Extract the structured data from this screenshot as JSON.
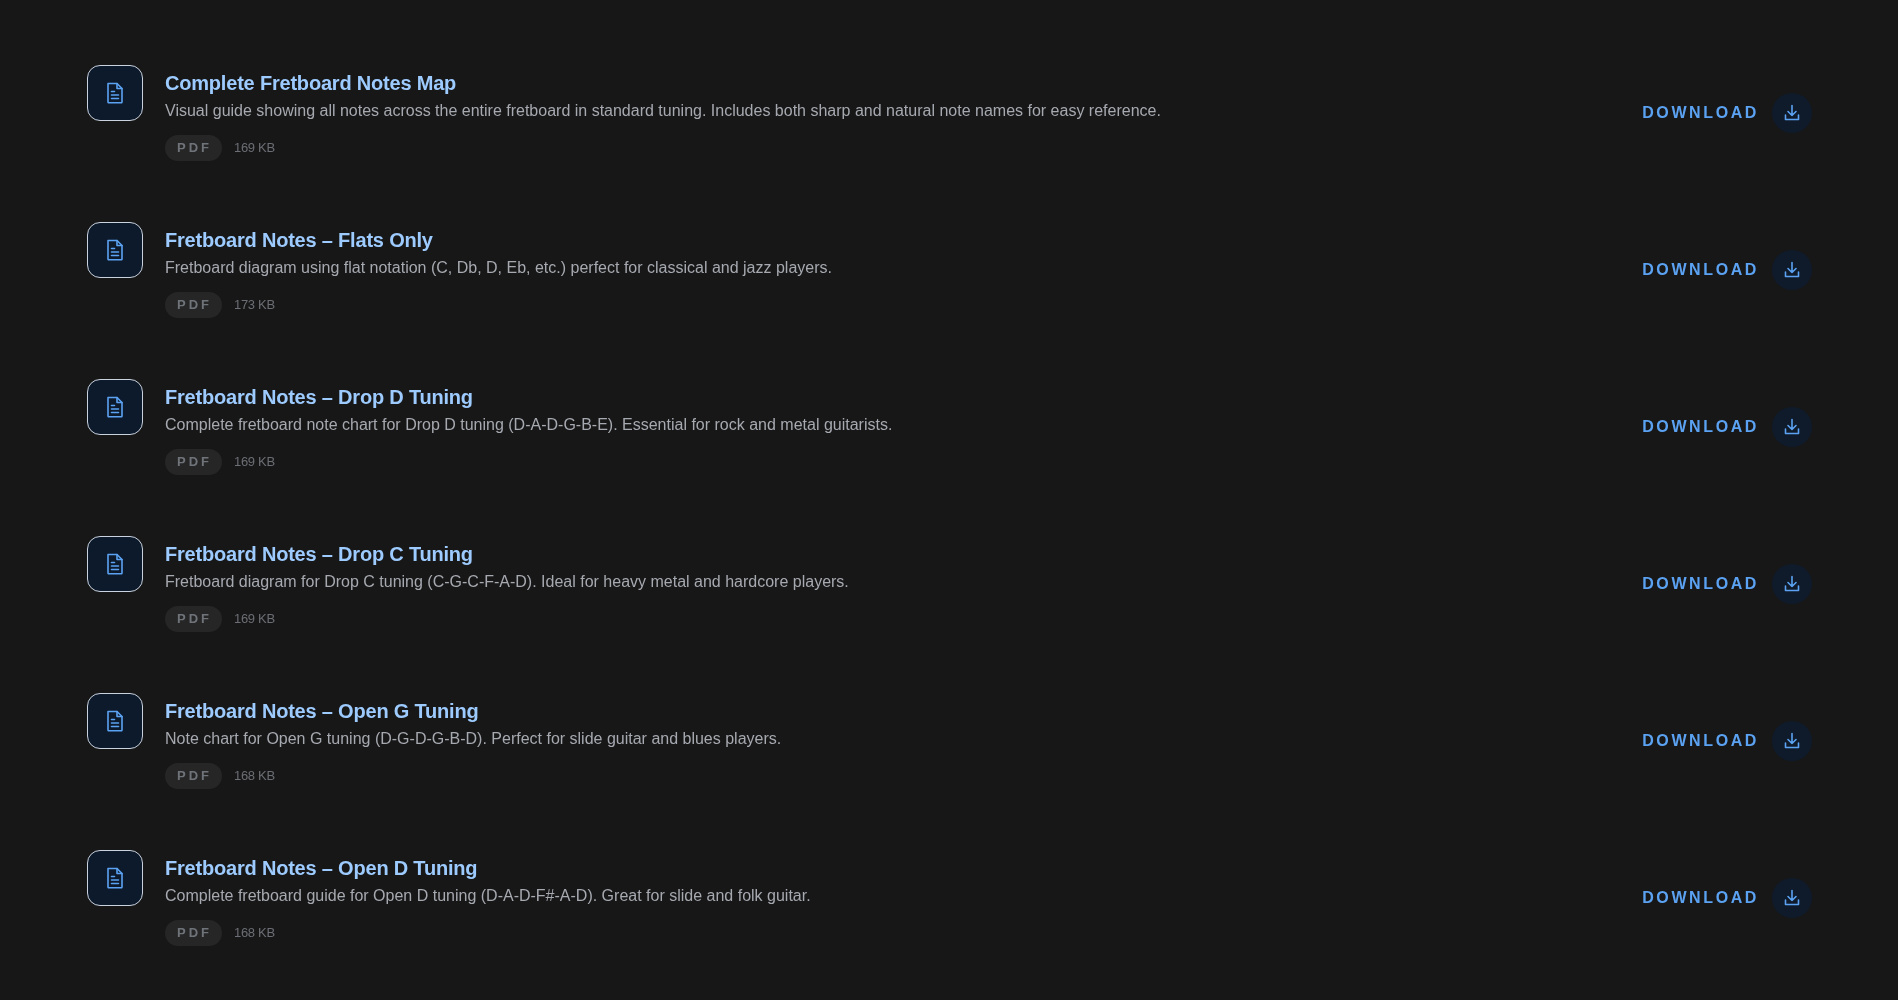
{
  "files": [
    {
      "title": "Complete Fretboard Notes Map",
      "description": "Visual guide showing all notes across the entire fretboard in standard tuning. Includes both sharp and natural note names for easy reference.",
      "format": "PDF",
      "size": "169 KB",
      "action": "DOWNLOAD"
    },
    {
      "title": "Fretboard Notes – Flats Only",
      "description": "Fretboard diagram using flat notation (C, Db, D, Eb, etc.) perfect for classical and jazz players.",
      "format": "PDF",
      "size": "173 KB",
      "action": "DOWNLOAD"
    },
    {
      "title": "Fretboard Notes – Drop D Tuning",
      "description": "Complete fretboard note chart for Drop D tuning (D-A-D-G-B-E). Essential for rock and metal guitarists.",
      "format": "PDF",
      "size": "169 KB",
      "action": "DOWNLOAD"
    },
    {
      "title": "Fretboard Notes – Drop C Tuning",
      "description": "Fretboard diagram for Drop C tuning (C-G-C-F-A-D). Ideal for heavy metal and hardcore players.",
      "format": "PDF",
      "size": "169 KB",
      "action": "DOWNLOAD"
    },
    {
      "title": "Fretboard Notes – Open G Tuning",
      "description": "Note chart for Open G tuning (D-G-D-G-B-D). Perfect for slide guitar and blues players.",
      "format": "PDF",
      "size": "168 KB",
      "action": "DOWNLOAD"
    },
    {
      "title": "Fretboard Notes – Open D Tuning",
      "description": "Complete fretboard guide for Open D tuning (D-A-D-F#-A-D). Great for slide and folk guitar.",
      "format": "PDF",
      "size": "168 KB",
      "action": "DOWNLOAD"
    }
  ]
}
